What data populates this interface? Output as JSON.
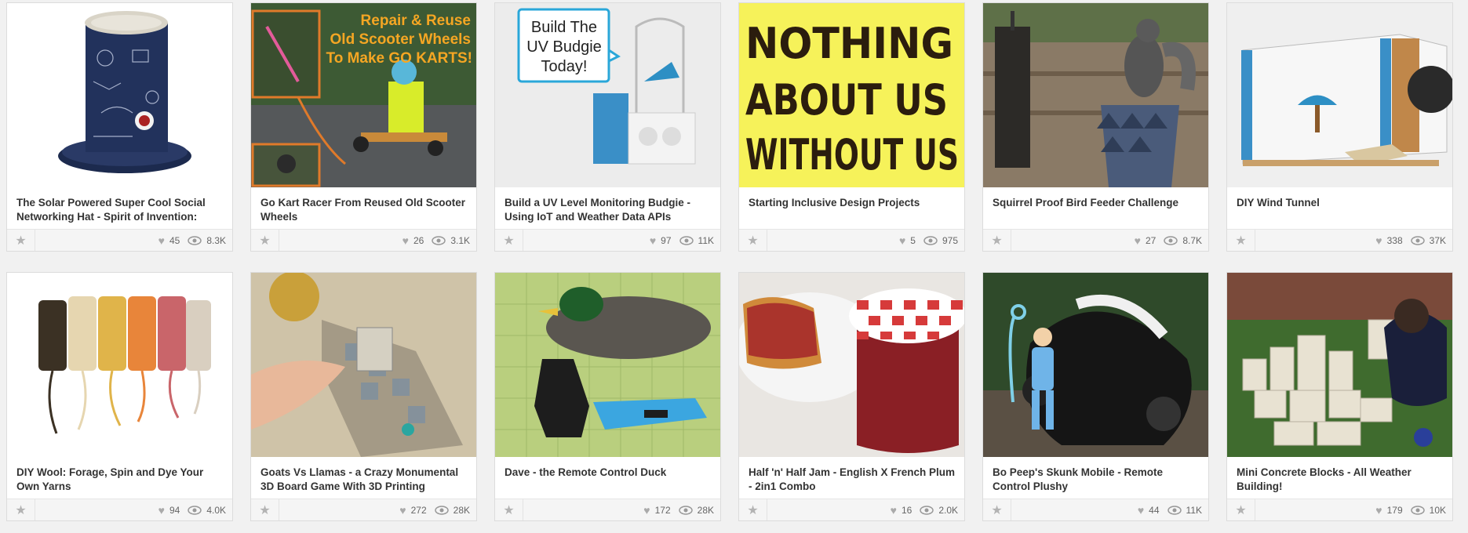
{
  "cards": [
    {
      "title": "The Solar Powered Super Cool Social Networking Hat - Spirit of Invention:",
      "favorites": "45",
      "views": "8.3K",
      "image": "solar-hat"
    },
    {
      "title": "Go Kart Racer From Reused Old Scooter Wheels",
      "favorites": "26",
      "views": "3.1K",
      "image": "go-kart",
      "overlay": [
        "Repair & Reuse",
        "Old Scooter Wheels",
        "To Make GO KARTS!"
      ]
    },
    {
      "title": "Build a UV Level Monitoring Budgie - Using IoT and Weather Data APIs",
      "favorites": "97",
      "views": "11K",
      "image": "uv-budgie",
      "overlay": [
        "Build The",
        "UV Budgie",
        "Today!"
      ]
    },
    {
      "title": "Starting Inclusive Design Projects",
      "favorites": "5",
      "views": "975",
      "image": "nothing-about-us",
      "overlay": [
        "NOTHING",
        "ABOUT US",
        "WITHOUT US"
      ]
    },
    {
      "title": "Squirrel Proof Bird Feeder Challenge",
      "favorites": "27",
      "views": "8.7K",
      "image": "squirrel"
    },
    {
      "title": "DIY Wind Tunnel",
      "favorites": "338",
      "views": "37K",
      "image": "wind-tunnel"
    },
    {
      "title": "DIY Wool: Forage, Spin and Dye Your Own Yarns",
      "favorites": "94",
      "views": "4.0K",
      "image": "wool"
    },
    {
      "title": "Goats Vs Llamas - a Crazy Monumental 3D Board Game With 3D Printing",
      "favorites": "272",
      "views": "28K",
      "image": "board-game"
    },
    {
      "title": "Dave - the Remote Control Duck",
      "favorites": "172",
      "views": "28K",
      "image": "rc-duck"
    },
    {
      "title": "Half 'n' Half Jam - English X French Plum - 2in1 Combo",
      "favorites": "16",
      "views": "2.0K",
      "image": "jam"
    },
    {
      "title": "Bo Peep's Skunk Mobile - Remote Control Plushy",
      "favorites": "44",
      "views": "11K",
      "image": "skunk"
    },
    {
      "title": "Mini Concrete Blocks - All Weather Building!",
      "favorites": "179",
      "views": "10K",
      "image": "concrete-blocks"
    }
  ],
  "icons": {
    "favorite": "star-icon",
    "likes": "heart-icon",
    "views": "eye-icon"
  },
  "colors": {
    "background": "#f1f1f1",
    "card": "#ffffff",
    "meta_bar": "#f5f5f5",
    "title_text": "#333333",
    "stat_text": "#666666"
  }
}
